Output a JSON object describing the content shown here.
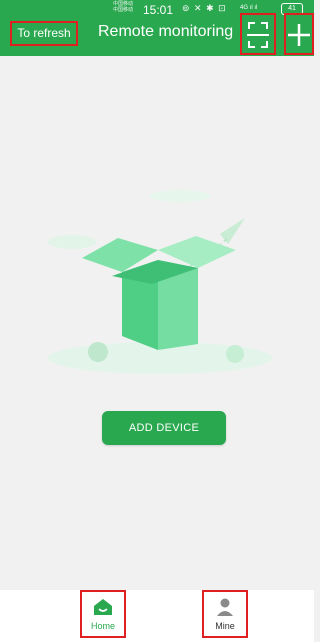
{
  "status_bar": {
    "carrier": "中国移动\n中国移动",
    "time": "15:01",
    "icons": "⊚ ✕ ✱ ⊡",
    "signal": "4G ıl ıl",
    "battery": "41"
  },
  "header": {
    "refresh_label": "To refresh",
    "title": "Remote monitoring",
    "scan_icon": "scan-icon",
    "add_icon": "plus-icon",
    "color": "#2aa84f"
  },
  "main": {
    "add_device_label": "ADD DEVICE",
    "illustration": "empty-box-illustration"
  },
  "tabbar": {
    "items": [
      {
        "label": "Home",
        "icon": "home-icon",
        "active": true
      },
      {
        "label": "Mine",
        "icon": "user-icon",
        "active": false
      }
    ]
  },
  "colors": {
    "accent": "#2aa84f",
    "highlight": "#e02020",
    "background": "#f1f1f1"
  }
}
